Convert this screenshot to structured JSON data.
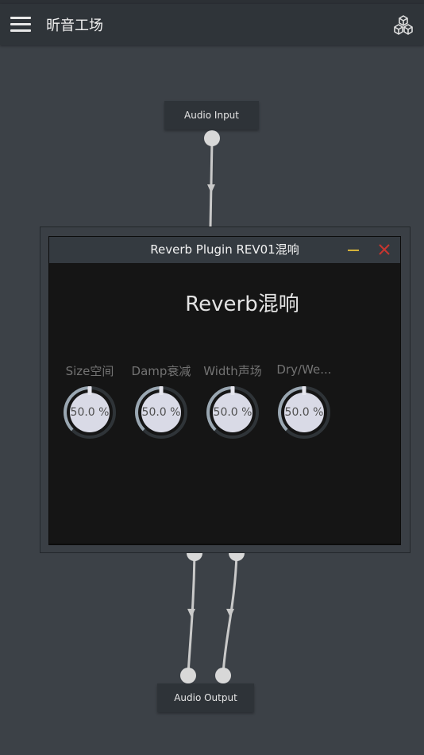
{
  "app": {
    "title": "昕音工场",
    "menu_icon": "hamburger-menu-icon",
    "action_icon": "cubes-icon"
  },
  "graph": {
    "input_node": "Audio Input",
    "output_node": "Audio Output"
  },
  "plugin": {
    "window_title": "Reverb Plugin REV01混响",
    "heading": "Reverb混响",
    "minimize_color": "#d4b13a",
    "close_color": "#c8352f",
    "knobs": [
      {
        "label": "Size空间",
        "value_text": "50.0 %",
        "value": 50.0
      },
      {
        "label": "Damp衰减",
        "value_text": "50.0 %",
        "value": 50.0
      },
      {
        "label": "Width声场",
        "value_text": "50.0 %",
        "value": 50.0
      },
      {
        "label": "Dry/We...",
        "value_text": "50.0 %",
        "value": 50.0
      }
    ]
  }
}
